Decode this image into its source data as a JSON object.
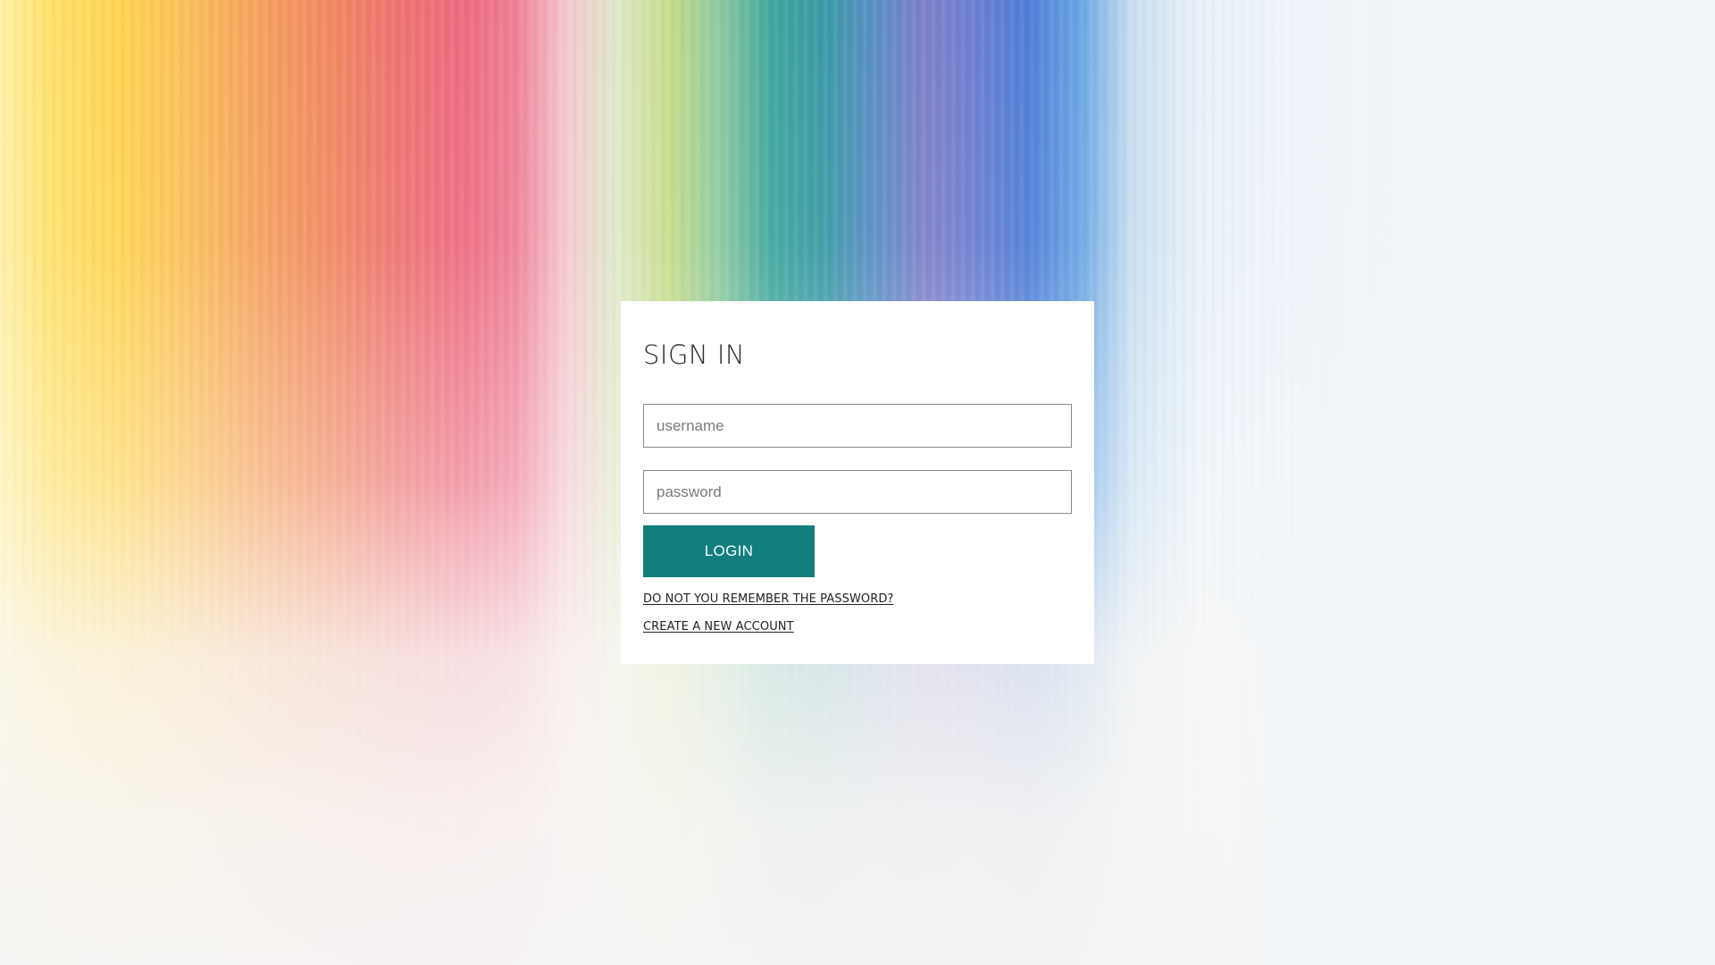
{
  "login": {
    "title": "SIGN IN",
    "username_placeholder": "username",
    "password_placeholder": "password",
    "username_value": "",
    "password_value": "",
    "login_button": "LOGIN",
    "forgot_password_link": "DO NOT YOU REMEMBER THE PASSWORD?",
    "create_account_link": "CREATE A NEW ACCOUNT"
  },
  "colors": {
    "accent": "#127f7e",
    "card_background": "#ffffff",
    "field_border": "#8a8a8a",
    "text": "#2b2b2b"
  }
}
